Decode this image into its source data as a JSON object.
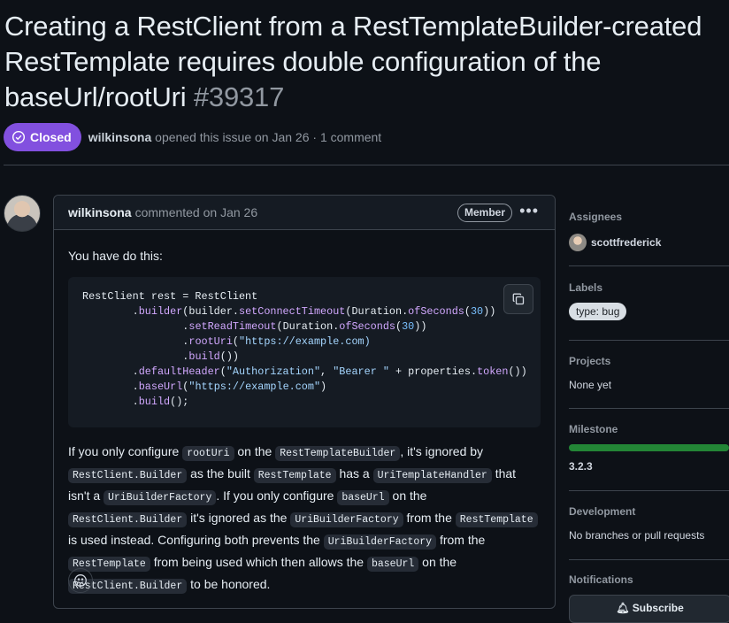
{
  "issue": {
    "title": "Creating a RestClient from a RestTemplateBuilder-created RestTemplate requires double configuration of the baseUrl/rootUri",
    "number": "#39317",
    "state_label": "Closed",
    "author": "wilkinsona",
    "meta_text": "opened this issue on Jan 26 · 1 comment",
    "state_color": "#8250df"
  },
  "comment": {
    "author": "wilkinsona",
    "header_text": "commented on Jan 26",
    "role_badge": "Member",
    "intro": "You have do this:",
    "code_lines": [
      "RestClient rest = RestClient",
      "        .builder(builder.setConnectTimeout(Duration.ofSeconds(30))",
      "                .setReadTimeout(Duration.ofSeconds(30))",
      "                .rootUri(\"https://example.com)",
      "                .build())",
      "        .defaultHeader(\"Authorization\", \"Bearer \" + properties.token())",
      "        .baseUrl(\"https://example.com\")",
      "        .build();"
    ],
    "paragraph": {
      "t1": "If you only configure ",
      "c1": "rootUri",
      "t2": " on the ",
      "c2": "RestTemplateBuilder",
      "t3": ", it's ignored by ",
      "c3": "RestClient.Builder",
      "t4": " as the built ",
      "c4": "RestTemplate",
      "t5": " has a ",
      "c5": "UriTemplateHandler",
      "t6": " that isn't a ",
      "c6": "UriBuilderFactory",
      "t7": ". If you only configure ",
      "c7": "baseUrl",
      "t8": " on the ",
      "c8": "RestClient.Builder",
      "t9": " it's ignored as the ",
      "c9": "UriBuilderFactory",
      "t10": " from the ",
      "c10": "RestTemplate",
      "t11": " is used instead. Configuring both prevents the ",
      "c11": "UriBuilderFactory",
      "t12": " from the ",
      "c12": "RestTemplate",
      "t13": " from being used which then allows the ",
      "c13": "baseUrl",
      "t14": " on the ",
      "c14": "RestClient.Builder",
      "t15": " to be honored."
    }
  },
  "sidebar": {
    "assignees_title": "Assignees",
    "assignee": "scottfrederick",
    "labels_title": "Labels",
    "label": "type: bug",
    "projects_title": "Projects",
    "projects_value": "None yet",
    "milestone_title": "Milestone",
    "milestone_value": "3.2.3",
    "milestone_progress": 1.0,
    "development_title": "Development",
    "development_value": "No branches or pull requests",
    "notifications_title": "Notifications",
    "subscribe_label": "Subscribe"
  }
}
